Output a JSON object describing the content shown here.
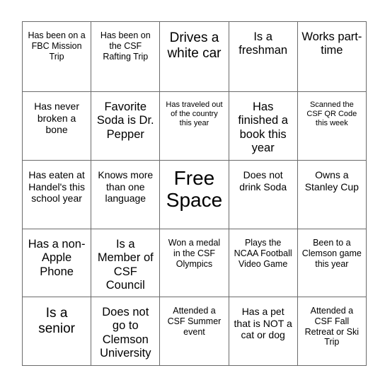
{
  "card": {
    "name": "bingo-card",
    "free_space_label": "Free Space",
    "border_color": "#6b6b6b",
    "background_color": "#ffffff",
    "text_color": "#000000",
    "columns": 5,
    "rows": 5,
    "cells": [
      [
        {
          "text": "Has been on a FBC Mission Trip",
          "size": "sm"
        },
        {
          "text": "Has been on the CSF Rafting Trip",
          "size": "sm"
        },
        {
          "text": "Drives a white car",
          "size": "xl"
        },
        {
          "text": "Is a freshman",
          "size": "lg"
        },
        {
          "text": "Works part-time",
          "size": "lg"
        }
      ],
      [
        {
          "text": "Has never broken a bone",
          "size": "md"
        },
        {
          "text": "Favorite Soda is Dr. Pepper",
          "size": "lg"
        },
        {
          "text": "Has traveled out of the country this year",
          "size": "xs"
        },
        {
          "text": "Has finished a book this year",
          "size": "lg"
        },
        {
          "text": "Scanned the CSF QR Code this week",
          "size": "xs"
        }
      ],
      [
        {
          "text": "Has eaten at Handel's this school year",
          "size": "md"
        },
        {
          "text": "Knows more than one language",
          "size": "md"
        },
        {
          "text": "Free Space",
          "size": "free"
        },
        {
          "text": "Does not drink Soda",
          "size": "md"
        },
        {
          "text": "Owns a Stanley Cup",
          "size": "md"
        }
      ],
      [
        {
          "text": "Has a non-Apple Phone",
          "size": "lg"
        },
        {
          "text": "Is a Member of CSF Council",
          "size": "lg"
        },
        {
          "text": "Won a medal in the CSF Olympics",
          "size": "sm"
        },
        {
          "text": "Plays the NCAA Football Video Game",
          "size": "sm"
        },
        {
          "text": "Been to a Clemson game this year",
          "size": "sm"
        }
      ],
      [
        {
          "text": "Is a senior",
          "size": "xl"
        },
        {
          "text": "Does not go to Clemson University",
          "size": "lg"
        },
        {
          "text": "Attended a CSF Summer event",
          "size": "sm"
        },
        {
          "text": "Has a pet that is NOT a cat or dog",
          "size": "md"
        },
        {
          "text": "Attended a CSF Fall Retreat or Ski Trip",
          "size": "sm"
        }
      ]
    ]
  }
}
